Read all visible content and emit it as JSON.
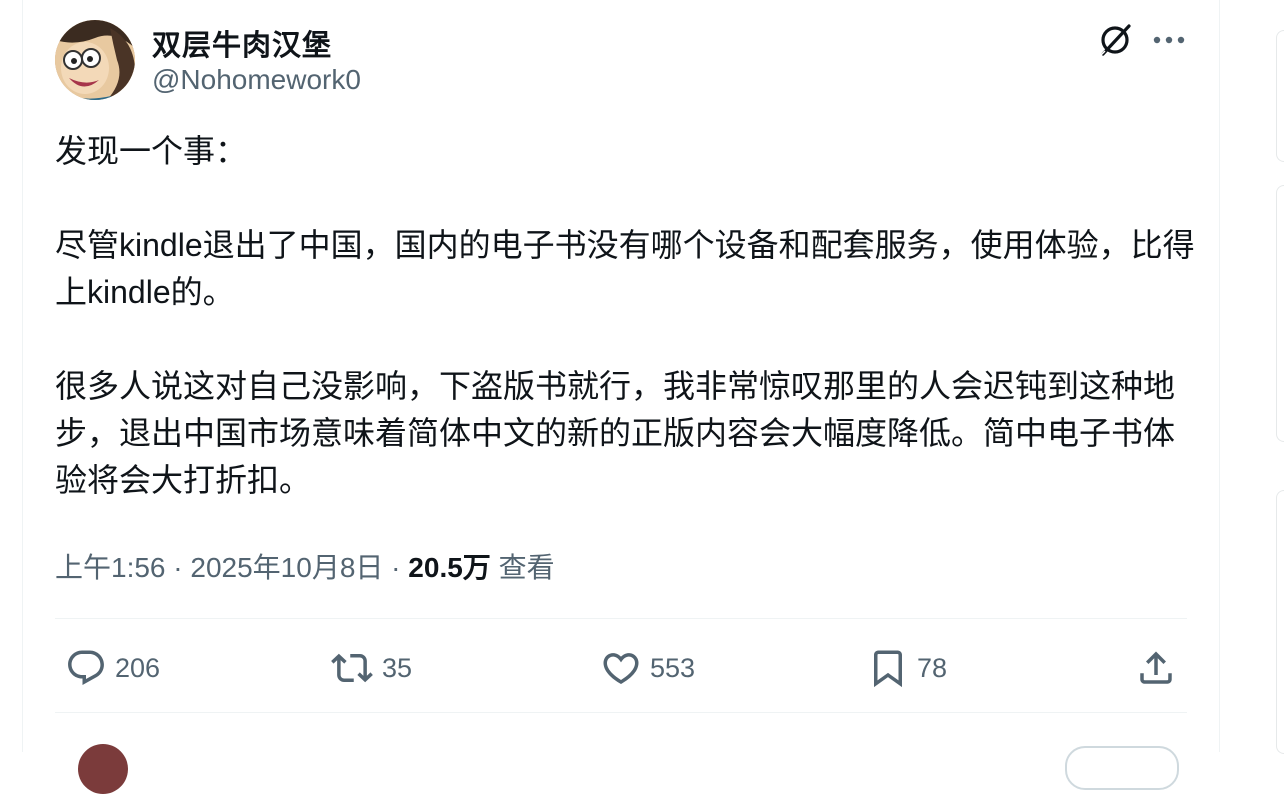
{
  "author": {
    "name": "双层牛肉汉堡",
    "handle": "@Nohomework0"
  },
  "header_icons": {
    "grok": "grok-slash-icon",
    "more": "more-horizontal-icon"
  },
  "tweet": {
    "paragraphs": [
      "发现一个事：",
      "尽管kindle退出了中国，国内的电子书没有哪个设备和配套服务，使用体验，比得上kindle的。",
      "很多人说这对自己没影响，下盗版书就行，我非常惊叹那里的人会迟钝到这种地步，退出中国市场意味着简体中文的新的正版内容会大幅度降低。简中电子书体验将会大打折扣。"
    ]
  },
  "meta": {
    "time": "上午1:56",
    "separator": " · ",
    "date": "2025年10月8日",
    "views_count": "20.5万",
    "views_label": "查看"
  },
  "actions": {
    "reply": {
      "icon": "reply-icon",
      "count": "206"
    },
    "retweet": {
      "icon": "retweet-icon",
      "count": "35"
    },
    "like": {
      "icon": "heart-icon",
      "count": "553"
    },
    "bookmark": {
      "icon": "bookmark-icon",
      "count": "78"
    },
    "share": {
      "icon": "share-icon"
    }
  },
  "colors": {
    "text_primary": "#0f1419",
    "text_secondary": "#536471",
    "divider": "#eff3f4"
  }
}
